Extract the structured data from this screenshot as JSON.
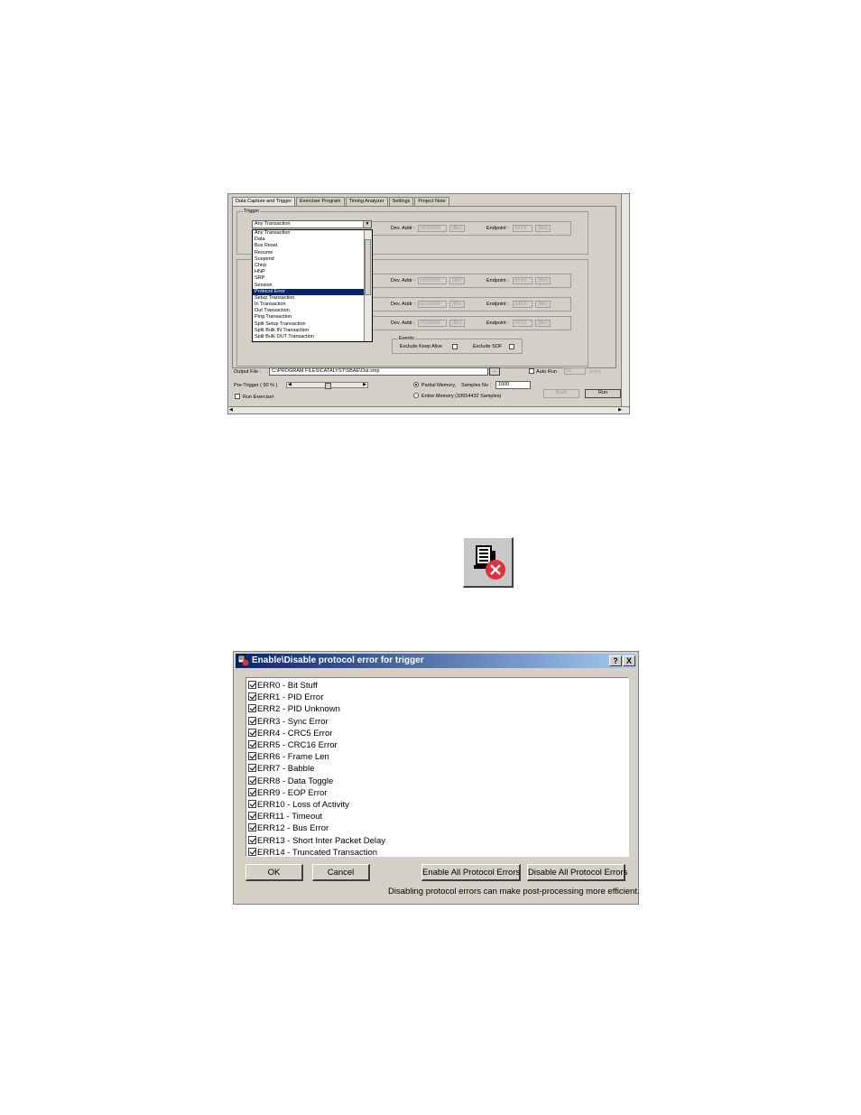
{
  "capture_window": {
    "tabs": [
      {
        "label": "Data Capture and Trigger"
      },
      {
        "label": "Exerciser Program"
      },
      {
        "label": "Timing Analyzer"
      },
      {
        "label": "Settings"
      },
      {
        "label": "Project Note"
      }
    ],
    "trigger_group_title": "Trigger",
    "trigger_combo_value": "Any Transaction",
    "trigger_options": [
      "Any Transaction",
      "Data",
      "Bus Reset",
      "Resume",
      "Suspend",
      "Chirp",
      "HNP",
      "SRP",
      "Session",
      "Protocol Error",
      "Setup Transaction",
      "In Transaction",
      "Out Transaction",
      "Ping Transaction",
      "Split Setup  Transaction",
      "Split Bulk  IN Transaction",
      "Split Bulk OUT Transaction"
    ],
    "selected_option": "Protocol Error",
    "dev_addr_label": "Dev. Addr :",
    "dev_addr_value": "XXXXXXX",
    "bin_label": "(Bin)",
    "endpoint_label": "Endpoint :",
    "endpoint_value": "XXXX",
    "events_group_title": "Events",
    "exclude_keep_alive_label": "Exclude Keep Alive",
    "exclude_sof_label": "Exclude SOF",
    "output_file_label": "Output File :",
    "output_file_value": "C:\\PROGRAM FILES\\CATALYST\\SBAE\\Out.smp",
    "browse_label": "...",
    "auto_run_label": "Auto Run",
    "auto_run_value": "30",
    "auto_run_unit": "(min)",
    "pre_trigger_label": "Pre-Trigger ( 50 % )",
    "pre_trigger_percent": 50,
    "partial_memory_label": "Partial Memory,",
    "samples_no_label": "Samples No :",
    "samples_no_value": "1000",
    "entire_memory_label": "Entire Memory (33554432 Samples)",
    "run_exerciser_label": "Run Exerciser",
    "back_label": "Back",
    "run_label": "Run"
  },
  "dialog": {
    "title": "Enable\\Disable  protocol error for trigger",
    "help_label": "?",
    "close_label": "X",
    "errors": [
      "ERR0 - Bit Stuff",
      "ERR1 - PID Error",
      "ERR2 - PID Unknown",
      "ERR3 - Sync Error",
      "ERR4 - CRC5 Error",
      "ERR5 - CRC16 Error",
      "ERR6 - Frame Len",
      "ERR7 - Babble",
      "ERR8 - Data Toggle",
      "ERR9 - EOP Error",
      "ERR10 - Loss of Activity",
      "ERR11 - Timeout",
      "ERR12 - Bus Error",
      "ERR13 - Short Inter Packet Delay",
      "ERR14 - Truncated Transaction"
    ],
    "ok_label": "OK",
    "cancel_label": "Cancel",
    "enable_all_label": "Enable All Protocol Errors",
    "disable_all_label": "Disable All Protocol Errors",
    "note": "Disabling protocol errors can make post-processing more efficient."
  },
  "icons": {
    "toolbar_icon": "protocol-error-trigger-icon"
  }
}
